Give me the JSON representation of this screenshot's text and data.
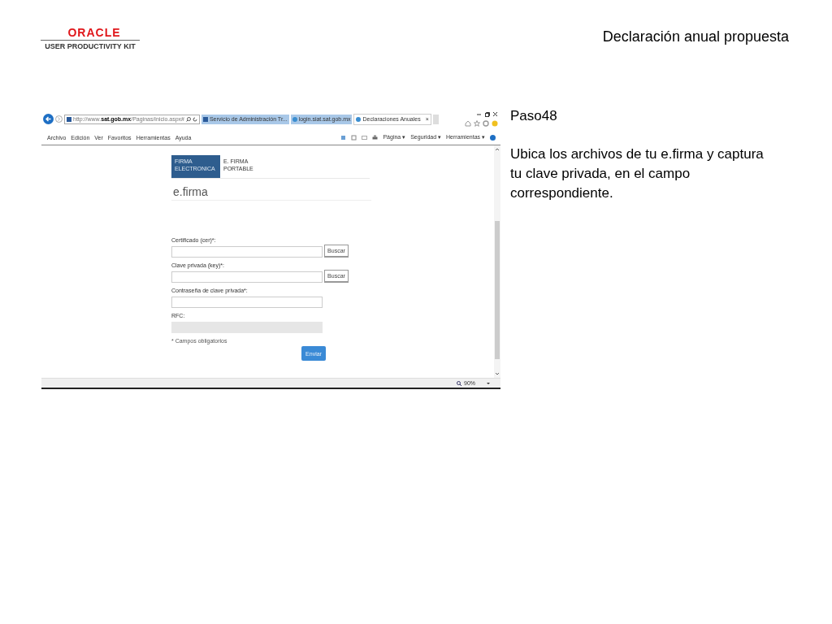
{
  "logo": {
    "brand": "ORACLE",
    "product": "USER PRODUCTIVITY KIT"
  },
  "slide_title": "Declaración anual propuesta",
  "browser": {
    "address": "http://www.**sat.gob.mx**/Paginas/inicio.aspx#",
    "tabs": [
      {
        "label": "Servicio de Administración Tr...",
        "selected": false
      },
      {
        "label": "login.siat.sat.gob.mx",
        "selected": false
      },
      {
        "label": "Declaraciones Anuales",
        "selected": true,
        "close": "×"
      }
    ],
    "menu": [
      "Archivo",
      "Edición",
      "Ver",
      "Favoritos",
      "Herramientas",
      "Ayuda"
    ],
    "commands": [
      "Página ▾",
      "Seguridad ▾",
      "Herramientas ▾"
    ],
    "zoom": "90%"
  },
  "page": {
    "tabs": [
      {
        "label": "FIRMA ELECTRONICA",
        "selected": true
      },
      {
        "label": "E. FIRMA PORTABLE",
        "selected": false
      }
    ],
    "heading": "e.firma",
    "fields": [
      {
        "label": "Certificado (cer)*:",
        "kind": "file",
        "button": "Buscar"
      },
      {
        "label": "Clave privada (key)*:",
        "kind": "file",
        "button": "Buscar"
      },
      {
        "label": "Contraseña de clave privada*:",
        "kind": "text"
      },
      {
        "label": "RFC:",
        "kind": "disabled"
      }
    ],
    "note": "* Campos obligatorios",
    "submit": "Enviar"
  },
  "step": {
    "title": "Paso48",
    "instruction": "Ubica los archivos de tu e.firma y captura tu clave privada, en el campo correspondiente."
  }
}
